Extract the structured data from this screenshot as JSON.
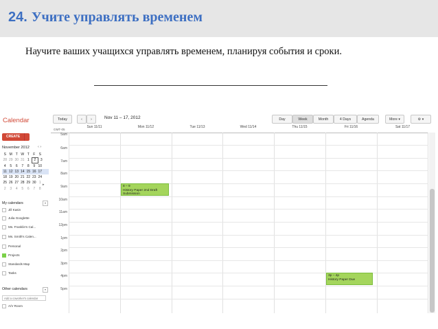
{
  "slide": {
    "number": "24.",
    "title": "Учите управлять временем",
    "subtitle": "Научите ваших учащихся управлять временем, планируя события и сроки."
  },
  "calendar": {
    "logo": "Calendar",
    "toolbar": {
      "today": "Today",
      "prev": "‹",
      "next": "›",
      "range": "Nov 11 – 17, 2012",
      "views": [
        "Day",
        "Week",
        "Month",
        "4 Days",
        "Agenda"
      ],
      "active_view": "Week",
      "more": "More ▾",
      "settings": "⚙ ▾"
    },
    "create": "CREATE",
    "mini": {
      "title": "November 2012",
      "nav": "‹ ›",
      "weekdays": [
        "S",
        "M",
        "T",
        "W",
        "T",
        "F",
        "S"
      ],
      "weeks": [
        [
          "28",
          "29",
          "30",
          "31",
          "1",
          "2",
          "3"
        ],
        [
          "4",
          "5",
          "6",
          "7",
          "8",
          "9",
          "10"
        ],
        [
          "11",
          "12",
          "13",
          "14",
          "15",
          "16",
          "17"
        ],
        [
          "18",
          "19",
          "20",
          "21",
          "22",
          "23",
          "24"
        ],
        [
          "25",
          "26",
          "27",
          "28",
          "29",
          "30",
          "1"
        ],
        [
          "2",
          "3",
          "4",
          "5",
          "6",
          "7",
          "8"
        ]
      ],
      "selected": "2"
    },
    "my_calendars": {
      "heading": "My calendars",
      "items": [
        "Jill Kasin",
        "Julia Googlette",
        "Ms. Franklin's Cal...",
        "Ms. Smith's Calen...",
        "Personal",
        "Projects",
        "Standards Map",
        "Tasks"
      ]
    },
    "other_calendars": {
      "heading": "Other calendars",
      "placeholder": "Add a coworker's calendar",
      "items": [
        "A/V Room"
      ]
    },
    "timezone": "GMT-05",
    "days": [
      "Sun 11/11",
      "Mon 11/12",
      "Tue 11/13",
      "Wed 11/14",
      "Thu 11/15",
      "Fri 11/16",
      "Sat 11/17"
    ],
    "hours": [
      "5am",
      "6am",
      "7am",
      "8am",
      "9am",
      "10am",
      "11am",
      "12pm",
      "1pm",
      "2pm",
      "3pm",
      "4pm",
      "5pm"
    ],
    "events": [
      {
        "time": "8 – 9",
        "title": "History Paper 2nd Draft Submission",
        "color": "#a4d55c"
      },
      {
        "time": "3p – 4p",
        "title": "History Paper Due",
        "color": "#a4d55c"
      }
    ]
  }
}
